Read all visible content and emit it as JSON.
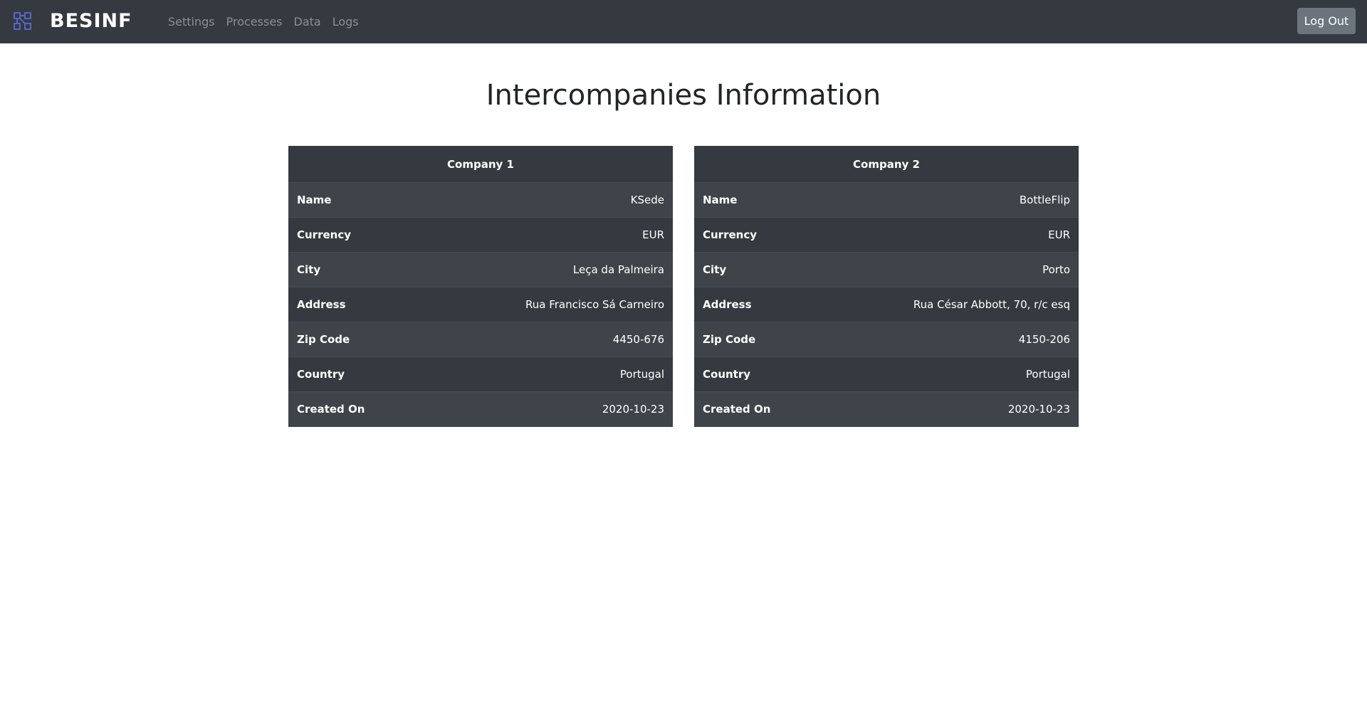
{
  "navbar": {
    "brand": "BESINF",
    "links": [
      "Settings",
      "Processes",
      "Data",
      "Logs"
    ],
    "logout_label": "Log Out",
    "logo_icon": "network-nodes-icon",
    "logo_color": "#5865c9"
  },
  "page": {
    "title": "Intercompanies Information"
  },
  "companies": [
    {
      "header": "Company 1",
      "rows": [
        {
          "label": "Name",
          "value": "KSede"
        },
        {
          "label": "Currency",
          "value": "EUR"
        },
        {
          "label": "City",
          "value": "Leça da Palmeira"
        },
        {
          "label": "Address",
          "value": "Rua Francisco Sá Carneiro"
        },
        {
          "label": "Zip Code",
          "value": "4450-676"
        },
        {
          "label": "Country",
          "value": "Portugal"
        },
        {
          "label": "Created On",
          "value": "2020-10-23"
        }
      ]
    },
    {
      "header": "Company 2",
      "rows": [
        {
          "label": "Name",
          "value": "BottleFlip"
        },
        {
          "label": "Currency",
          "value": "EUR"
        },
        {
          "label": "City",
          "value": "Porto"
        },
        {
          "label": "Address",
          "value": "Rua César Abbott, 70, r/c esq"
        },
        {
          "label": "Zip Code",
          "value": "4150-206"
        },
        {
          "label": "Country",
          "value": "Portugal"
        },
        {
          "label": "Created On",
          "value": "2020-10-23"
        }
      ]
    }
  ]
}
